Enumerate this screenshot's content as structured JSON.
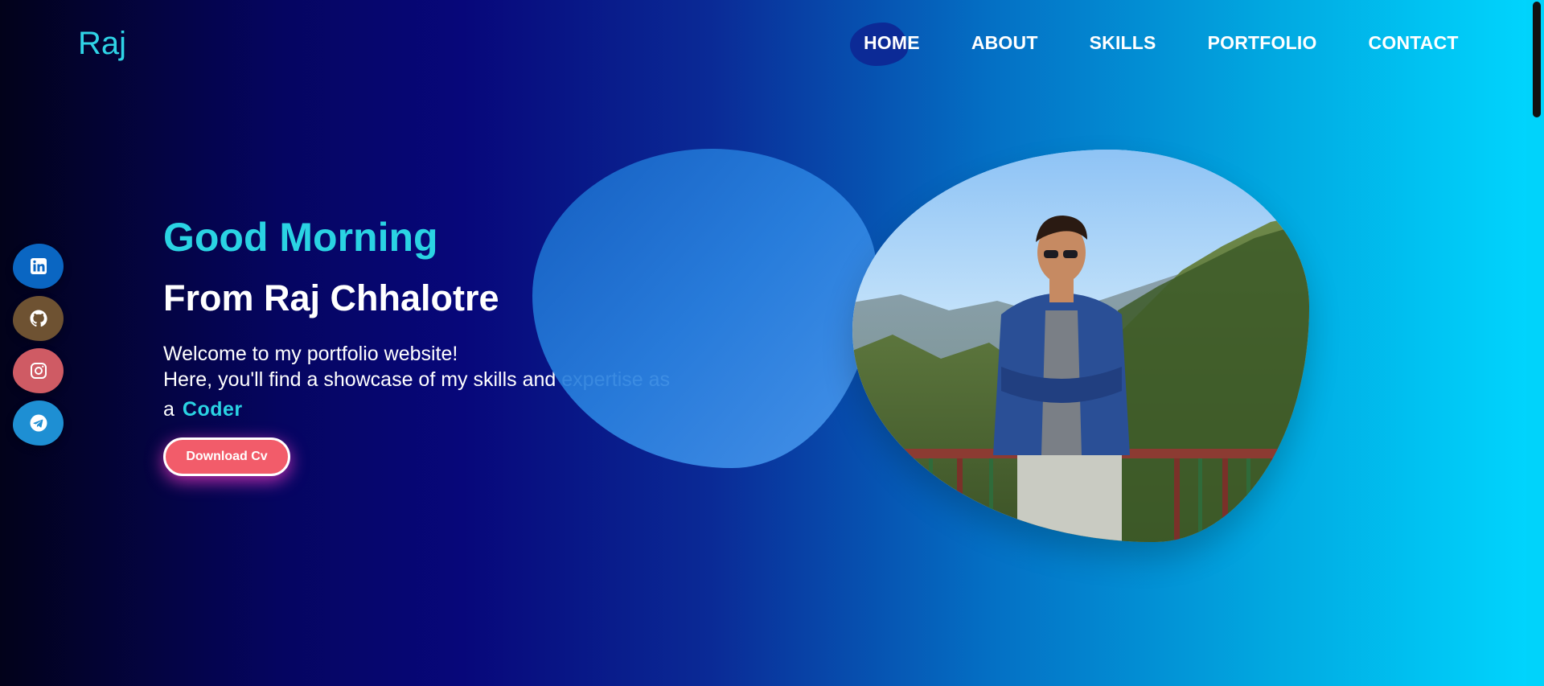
{
  "logo": "Raj",
  "nav": {
    "items": [
      {
        "label": "HOME"
      },
      {
        "label": "ABOUT"
      },
      {
        "label": "SKILLS"
      },
      {
        "label": "PORTFOLIO"
      },
      {
        "label": "CONTACT"
      }
    ],
    "active": "HOME"
  },
  "social": [
    {
      "icon": "linkedin-icon",
      "color": "#0a66c2"
    },
    {
      "icon": "github-icon",
      "color": "#6e5232"
    },
    {
      "icon": "instagram-icon",
      "color": "#cf5b64"
    },
    {
      "icon": "telegram-icon",
      "color": "#1e8fd3"
    }
  ],
  "hero": {
    "greeting": "Good Morning",
    "name": "From Raj Chhalotre",
    "desc_line1": "Welcome to my portfolio website!",
    "desc_line2": "Here, you'll find a showcase of my skills and expertise as",
    "role_prefix": "a",
    "role": "Coder",
    "button_label": "Download Cv"
  },
  "colors": {
    "accent": "#2ad3e3",
    "button": "#f25c6a"
  }
}
